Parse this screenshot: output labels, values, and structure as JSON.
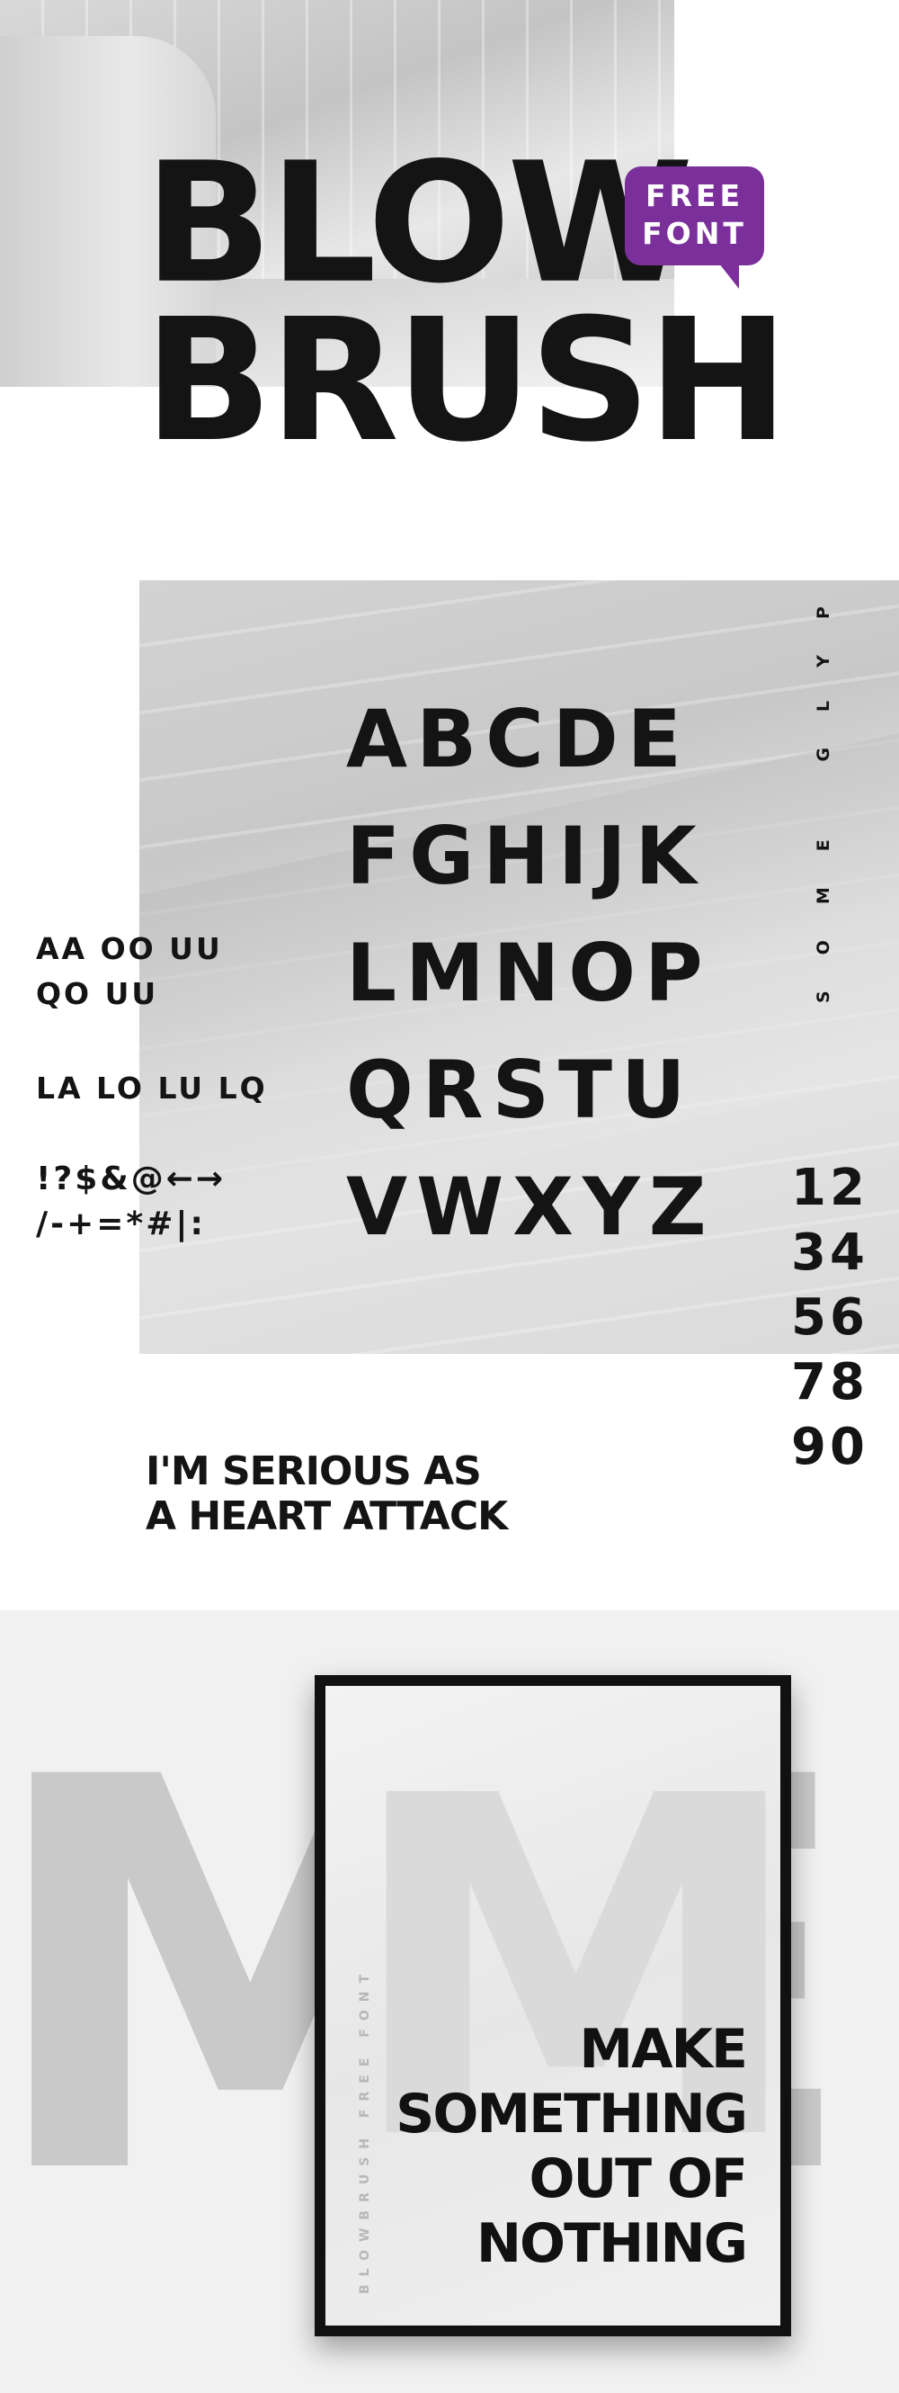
{
  "hero": {
    "title_line1": "BLOW",
    "title_line2": "BRUSH",
    "badge": "FREE FONT"
  },
  "glyphs": {
    "alphabet_rows": [
      "ABCDE",
      "FGHIJK",
      "LMNOP",
      "QRSTU",
      "VWXYZ"
    ],
    "alternates": [
      "AA OO UU",
      "QO UU",
      "LA LO LU LQ"
    ],
    "symbols": [
      "!?$&@←→",
      "/-+=*#|:"
    ],
    "some_glyph_label": "SOME GLYP",
    "numbers": [
      "12",
      "34",
      "56",
      "78",
      "90"
    ]
  },
  "sample_text": {
    "line1": "I'M SERIOUS AS",
    "line2": "A HEART ATTACK"
  },
  "poster": {
    "background_letters": "ME",
    "big_letter": "M",
    "vertical_label": "BLOWBRUSH FREE FONT",
    "lines": [
      "MAKE",
      "SOMETHING",
      "OUT OF",
      "NOTHING"
    ]
  },
  "colors": {
    "badge": "#7a2f9a",
    "ink": "#141414",
    "photo_gray": "#cfcfcf"
  }
}
